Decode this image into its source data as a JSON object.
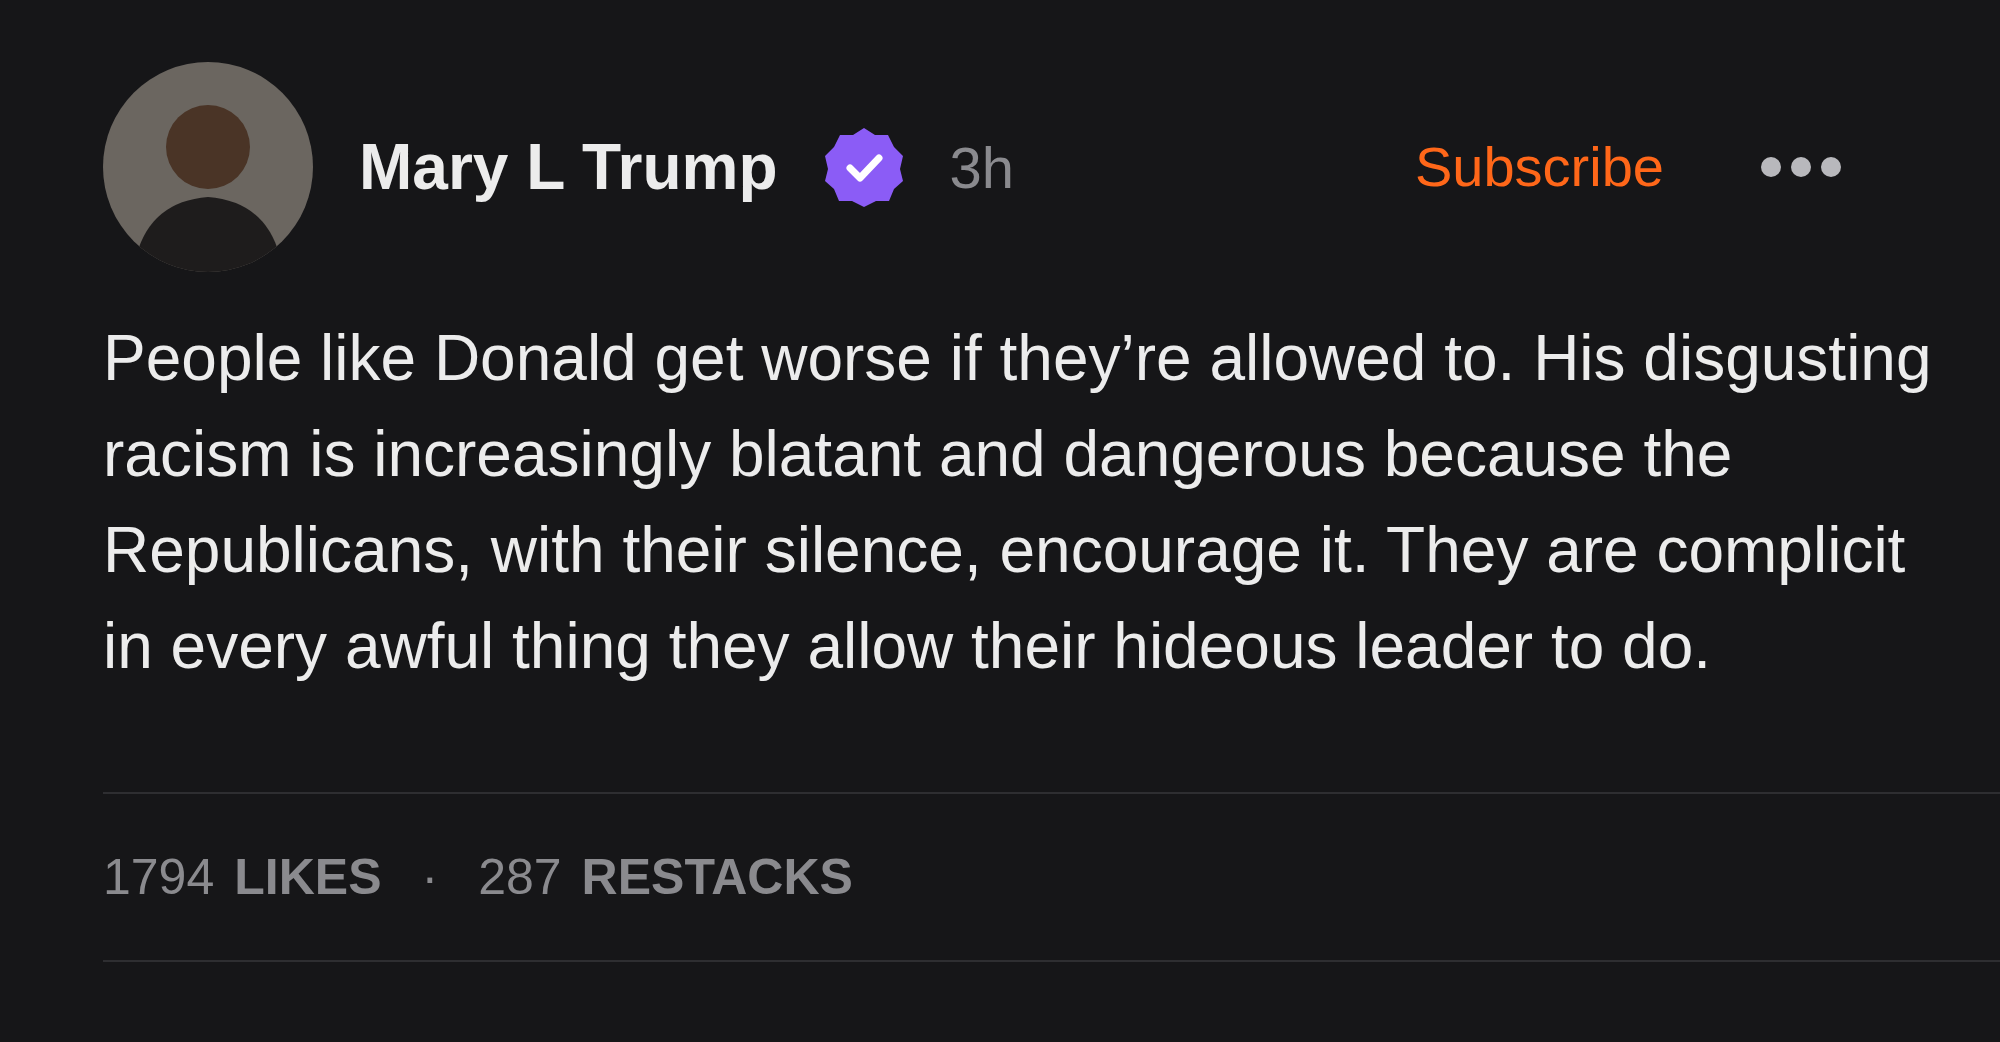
{
  "post": {
    "author": {
      "name": "Mary L Trump",
      "verified": true
    },
    "time": "3h",
    "subscribe": "Subscribe",
    "body": "People like Donald get worse if they’re allowed to. His disgusting racism is increasingly blatant and dangerous because the Republicans, with their silence, encourage it. They are complicit in every awful thing they allow their hideous leader to do.",
    "stats": [
      {
        "count": "1794",
        "label": "LIKES"
      },
      {
        "count": "287",
        "label": "RESTACKS"
      }
    ],
    "separator": "·"
  }
}
